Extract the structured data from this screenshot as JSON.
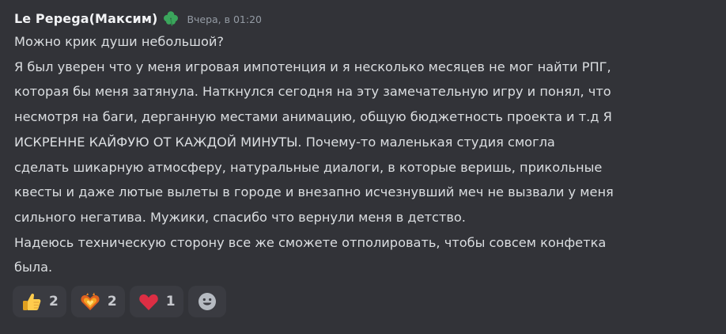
{
  "message": {
    "author": "Le Pepega(Максим)",
    "role_icon": "clover-icon",
    "timestamp": "Вчера, в 01:20",
    "lines": [
      "Можно крик души небольшой?",
      "Я был уверен что у меня игровая импотенция и я несколько месяцев не мог найти РПГ,",
      "которая бы меня затянула. Наткнулся сегодня на эту замечательную игру и понял, что",
      "несмотря на баги, дерганную местами анимацию, общую бюджетность проекта и т.д Я",
      "ИСКРЕННЕ КАЙФУЮ ОТ КАЖДОЙ МИНУТЫ. Почему-то маленькая студия смогла",
      "сделать шикарную атмосферу, натуральные диалоги, в которые веришь, прикольные",
      "квесты и даже лютые вылеты в городе и внезапно исчезнувший меч не вызвали у меня",
      "сильного негатива. Мужики, спасибо что вернули меня в детство.",
      "Надеюсь техническую сторону все же сможете отполировать, чтобы совсем конфетка",
      "была."
    ]
  },
  "reactions": [
    {
      "icon": "thumbs-up-icon",
      "count": "2"
    },
    {
      "icon": "fire-heart-icon",
      "count": "2"
    },
    {
      "icon": "red-heart-icon",
      "count": "1"
    }
  ],
  "add_reaction_icon": "add-reaction-icon",
  "colors": {
    "background": "#323338",
    "username": "#f2f3f5",
    "text": "#dbdee1",
    "timestamp": "#949ba4",
    "reaction_bg": "#3a3b41",
    "clover": "#3ba55c"
  }
}
